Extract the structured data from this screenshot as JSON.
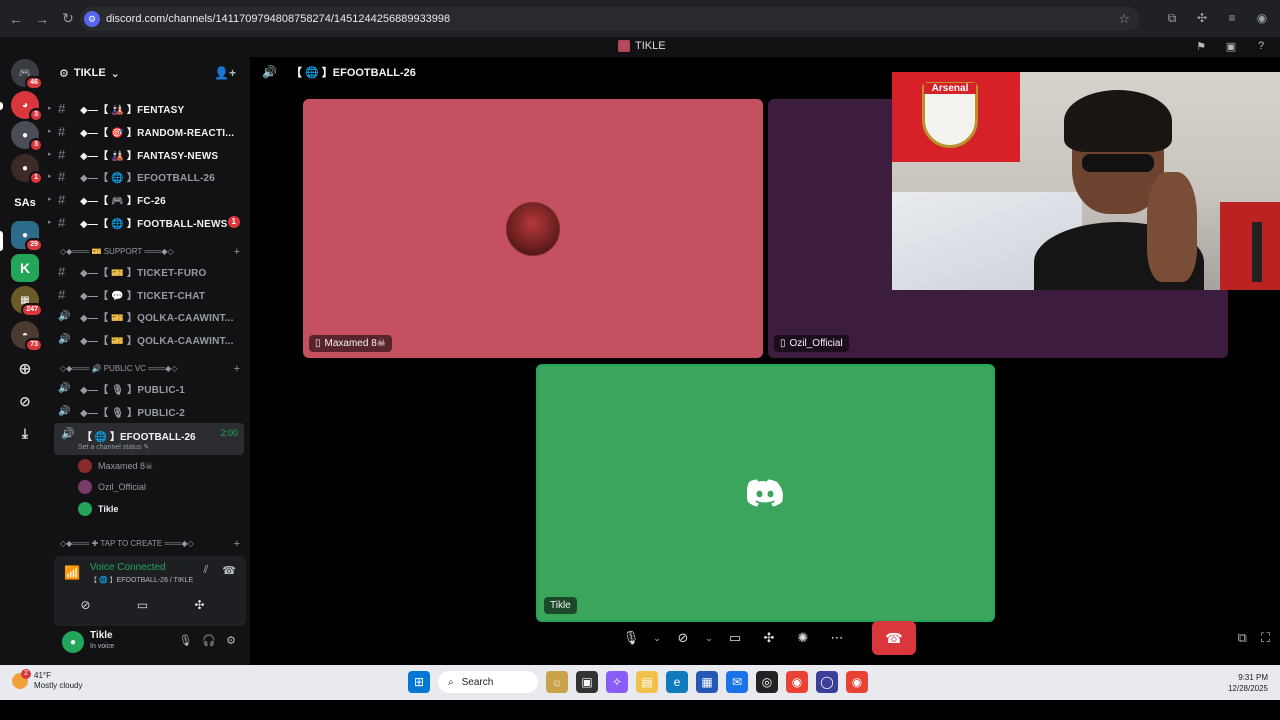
{
  "browser": {
    "url": "discord.com/channels/1411709794808758274/1451244256889933998"
  },
  "titlebar": {
    "title": "TIKLE"
  },
  "rail": {
    "servers": [
      {
        "badge": "46",
        "color": "#3a3c43"
      },
      {
        "badge": "3",
        "color": "#da373c"
      },
      {
        "badge": "3",
        "color": "#4a4d55"
      },
      {
        "badge": "1",
        "color": "#3b2a25"
      },
      {
        "label": "SAs",
        "color": "#121214"
      },
      {
        "badge": "29",
        "color": "#2c6b8a"
      },
      {
        "label": "K",
        "color": "#23a55a"
      },
      {
        "badge": "247",
        "color": "#6b5a2a"
      },
      {
        "badge": "73",
        "color": "#4a3a30"
      }
    ]
  },
  "sidebar": {
    "server_name": "TIKLE",
    "channels": [
      {
        "name": "◆—【 🎎 】FENTASY",
        "icon": "#"
      },
      {
        "name": "◆—【 🎯 】RANDOM-REACTI...",
        "icon": "#"
      },
      {
        "name": "◆—【 🎎 】FANTASY-NEWS",
        "icon": "#"
      },
      {
        "name": "◆—【 🌐 】EFOOTBALL-26",
        "icon": "#"
      },
      {
        "name": "◆—【 🎮 】FC-26",
        "icon": "#"
      },
      {
        "name": "◆—【 🌐 】FOOTBALL-NEWS",
        "icon": "#",
        "mention": "1"
      }
    ],
    "category_support": "◇◆═══ 🎫 SUPPORT ═══◆◇",
    "support_channels": [
      {
        "name": "◆—【 🎫 】TICKET-FURO",
        "icon": "#"
      },
      {
        "name": "◆—【 💬 】TICKET-CHAT",
        "icon": "#"
      },
      {
        "name": "◆—【 🎫 】QOLKA-CAAWINT...",
        "icon": "🔊"
      },
      {
        "name": "◆—【 🎫 】QOLKA-CAAWINT...",
        "icon": "🔊"
      }
    ],
    "category_public": "◇◆═══ 🔊 PUBLIC VC ═══◆◇",
    "public_channels": [
      {
        "name": "◆—【 🎙 】PUBLIC-1",
        "icon": "🔊"
      },
      {
        "name": "◆—【 🎙 】PUBLIC-2",
        "icon": "🔊"
      }
    ],
    "active_channel": {
      "name": "【 🌐 】EFOOTBALL-26",
      "time": "2:00",
      "status": "Set a channel status ✎"
    },
    "voice_users": [
      "Maxamed 8☠",
      "Ozil_Official",
      "Tikle"
    ],
    "category_create": "◇◆═══ ✚ TAP TO CREATE ═══◆◇",
    "voice_panel": {
      "title": "Voice Connected",
      "subtitle": "【 🌐 】EFOOTBALL-26 / TIKLE"
    },
    "user": {
      "name": "Tikle",
      "status": "In voice"
    }
  },
  "main": {
    "channel_title": "【 🌐 】EFOOTBALL-26",
    "tiles": {
      "red_label": "Maxamed 8☠",
      "purple_label": "Ozil_Official",
      "green_label": "Tikle"
    },
    "webcam_flag_text": "Arsenal"
  },
  "taskbar": {
    "weather_badge": "2",
    "temp": "41°F",
    "weather": "Mostly cloudy",
    "search": "Search",
    "time": "9:31 PM",
    "date": "12/28/2025"
  },
  "colors": {
    "tile_red": "#c5505f",
    "tile_purple": "#3d1d3d",
    "tile_green": "#3ba55c",
    "hangup": "#da373c",
    "voice_green": "#23a55a"
  }
}
